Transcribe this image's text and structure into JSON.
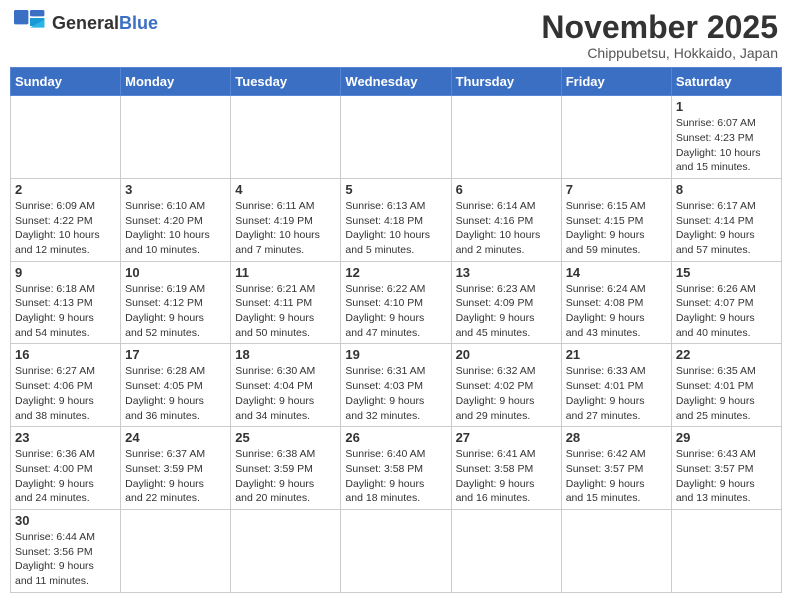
{
  "logo": {
    "text_normal": "General",
    "text_bold": "Blue"
  },
  "title": {
    "month_year": "November 2025",
    "location": "Chippubetsu, Hokkaido, Japan"
  },
  "weekdays": [
    "Sunday",
    "Monday",
    "Tuesday",
    "Wednesday",
    "Thursday",
    "Friday",
    "Saturday"
  ],
  "weeks": [
    [
      {
        "day": "",
        "info": ""
      },
      {
        "day": "",
        "info": ""
      },
      {
        "day": "",
        "info": ""
      },
      {
        "day": "",
        "info": ""
      },
      {
        "day": "",
        "info": ""
      },
      {
        "day": "",
        "info": ""
      },
      {
        "day": "1",
        "info": "Sunrise: 6:07 AM\nSunset: 4:23 PM\nDaylight: 10 hours\nand 15 minutes."
      }
    ],
    [
      {
        "day": "2",
        "info": "Sunrise: 6:09 AM\nSunset: 4:22 PM\nDaylight: 10 hours\nand 12 minutes."
      },
      {
        "day": "3",
        "info": "Sunrise: 6:10 AM\nSunset: 4:20 PM\nDaylight: 10 hours\nand 10 minutes."
      },
      {
        "day": "4",
        "info": "Sunrise: 6:11 AM\nSunset: 4:19 PM\nDaylight: 10 hours\nand 7 minutes."
      },
      {
        "day": "5",
        "info": "Sunrise: 6:13 AM\nSunset: 4:18 PM\nDaylight: 10 hours\nand 5 minutes."
      },
      {
        "day": "6",
        "info": "Sunrise: 6:14 AM\nSunset: 4:16 PM\nDaylight: 10 hours\nand 2 minutes."
      },
      {
        "day": "7",
        "info": "Sunrise: 6:15 AM\nSunset: 4:15 PM\nDaylight: 9 hours\nand 59 minutes."
      },
      {
        "day": "8",
        "info": "Sunrise: 6:17 AM\nSunset: 4:14 PM\nDaylight: 9 hours\nand 57 minutes."
      }
    ],
    [
      {
        "day": "9",
        "info": "Sunrise: 6:18 AM\nSunset: 4:13 PM\nDaylight: 9 hours\nand 54 minutes."
      },
      {
        "day": "10",
        "info": "Sunrise: 6:19 AM\nSunset: 4:12 PM\nDaylight: 9 hours\nand 52 minutes."
      },
      {
        "day": "11",
        "info": "Sunrise: 6:21 AM\nSunset: 4:11 PM\nDaylight: 9 hours\nand 50 minutes."
      },
      {
        "day": "12",
        "info": "Sunrise: 6:22 AM\nSunset: 4:10 PM\nDaylight: 9 hours\nand 47 minutes."
      },
      {
        "day": "13",
        "info": "Sunrise: 6:23 AM\nSunset: 4:09 PM\nDaylight: 9 hours\nand 45 minutes."
      },
      {
        "day": "14",
        "info": "Sunrise: 6:24 AM\nSunset: 4:08 PM\nDaylight: 9 hours\nand 43 minutes."
      },
      {
        "day": "15",
        "info": "Sunrise: 6:26 AM\nSunset: 4:07 PM\nDaylight: 9 hours\nand 40 minutes."
      }
    ],
    [
      {
        "day": "16",
        "info": "Sunrise: 6:27 AM\nSunset: 4:06 PM\nDaylight: 9 hours\nand 38 minutes."
      },
      {
        "day": "17",
        "info": "Sunrise: 6:28 AM\nSunset: 4:05 PM\nDaylight: 9 hours\nand 36 minutes."
      },
      {
        "day": "18",
        "info": "Sunrise: 6:30 AM\nSunset: 4:04 PM\nDaylight: 9 hours\nand 34 minutes."
      },
      {
        "day": "19",
        "info": "Sunrise: 6:31 AM\nSunset: 4:03 PM\nDaylight: 9 hours\nand 32 minutes."
      },
      {
        "day": "20",
        "info": "Sunrise: 6:32 AM\nSunset: 4:02 PM\nDaylight: 9 hours\nand 29 minutes."
      },
      {
        "day": "21",
        "info": "Sunrise: 6:33 AM\nSunset: 4:01 PM\nDaylight: 9 hours\nand 27 minutes."
      },
      {
        "day": "22",
        "info": "Sunrise: 6:35 AM\nSunset: 4:01 PM\nDaylight: 9 hours\nand 25 minutes."
      }
    ],
    [
      {
        "day": "23",
        "info": "Sunrise: 6:36 AM\nSunset: 4:00 PM\nDaylight: 9 hours\nand 24 minutes."
      },
      {
        "day": "24",
        "info": "Sunrise: 6:37 AM\nSunset: 3:59 PM\nDaylight: 9 hours\nand 22 minutes."
      },
      {
        "day": "25",
        "info": "Sunrise: 6:38 AM\nSunset: 3:59 PM\nDaylight: 9 hours\nand 20 minutes."
      },
      {
        "day": "26",
        "info": "Sunrise: 6:40 AM\nSunset: 3:58 PM\nDaylight: 9 hours\nand 18 minutes."
      },
      {
        "day": "27",
        "info": "Sunrise: 6:41 AM\nSunset: 3:58 PM\nDaylight: 9 hours\nand 16 minutes."
      },
      {
        "day": "28",
        "info": "Sunrise: 6:42 AM\nSunset: 3:57 PM\nDaylight: 9 hours\nand 15 minutes."
      },
      {
        "day": "29",
        "info": "Sunrise: 6:43 AM\nSunset: 3:57 PM\nDaylight: 9 hours\nand 13 minutes."
      }
    ],
    [
      {
        "day": "30",
        "info": "Sunrise: 6:44 AM\nSunset: 3:56 PM\nDaylight: 9 hours\nand 11 minutes."
      },
      {
        "day": "",
        "info": ""
      },
      {
        "day": "",
        "info": ""
      },
      {
        "day": "",
        "info": ""
      },
      {
        "day": "",
        "info": ""
      },
      {
        "day": "",
        "info": ""
      },
      {
        "day": "",
        "info": ""
      }
    ]
  ]
}
